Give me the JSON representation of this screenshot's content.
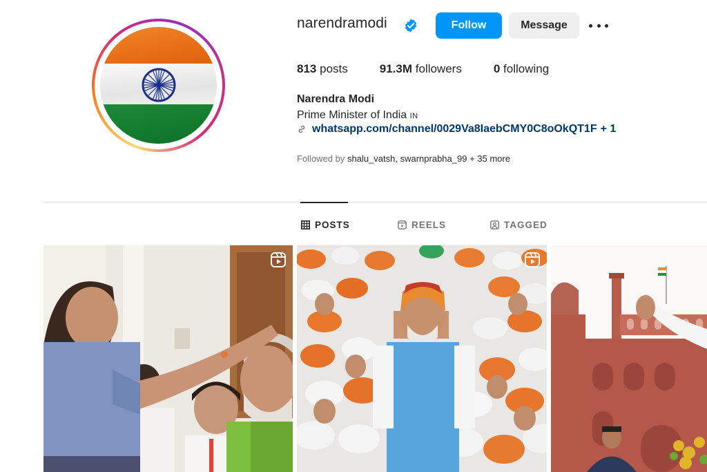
{
  "profile": {
    "username": "narendramodi",
    "follow_label": "Follow",
    "message_label": "Message",
    "stats": {
      "posts_count": "813",
      "posts_label": "posts",
      "followers_count": "91.3M",
      "followers_label": "followers",
      "following_count": "0",
      "following_label": "following"
    },
    "full_name": "Narendra Modi",
    "bio": "Prime Minister of India",
    "bio_country": "IN",
    "link": "whatsapp.com/channel/0029Va8IaebCMY0C8oOkQT1F",
    "link_more": "+ 1",
    "followed_by_prefix": "Followed by",
    "followed_by_names": "shalu_vatsh, swarnprabha_99",
    "followed_by_more": "+ 35 more"
  },
  "tabs": [
    {
      "label": "POSTS",
      "icon": "grid-icon",
      "active": true
    },
    {
      "label": "REELS",
      "icon": "reels-icon",
      "active": false
    },
    {
      "label": "TAGGED",
      "icon": "tagged-icon",
      "active": false
    }
  ],
  "posts": [
    {
      "type": "reel",
      "description_icon": "reel-icon"
    },
    {
      "type": "reel",
      "description_icon": "reel-icon"
    },
    {
      "type": "image"
    }
  ],
  "colors": {
    "follow_button": "#0095f6",
    "message_button": "#efefef",
    "link": "#00376b",
    "muted_text": "#737373",
    "verified_badge": "#0095f6"
  }
}
